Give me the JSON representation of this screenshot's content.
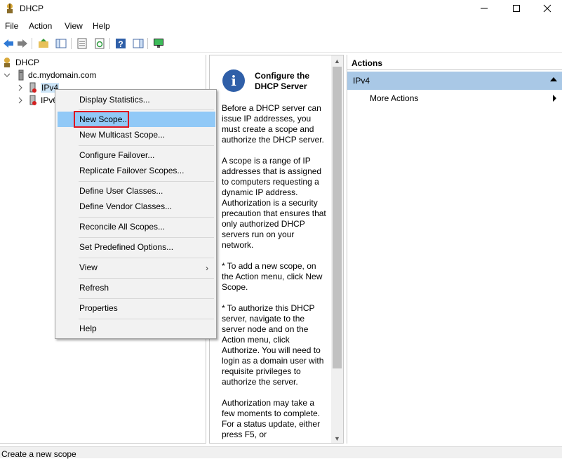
{
  "window": {
    "title": "DHCP"
  },
  "menubar": {
    "items": [
      "File",
      "Action",
      "View",
      "Help"
    ]
  },
  "tree": {
    "root": "DHCP",
    "server": "dc.mydomain.com",
    "ipv4": "IPv4",
    "ipv6": "IPv6"
  },
  "info": {
    "title": "Configure the DHCP Server",
    "paragraphs": [
      "Before a DHCP server can issue IP addresses, you must create a scope and authorize the DHCP server.",
      "A scope is a range of IP addresses that is assigned to computers requesting a dynamic IP address. Authorization is a security precaution that ensures that only authorized DHCP servers run on your network.",
      "* To add a new scope, on the Action menu, click New Scope.",
      "* To authorize this DHCP server, navigate to the server node and on the Action menu, click Authorize. You will need to login as a domain user with requisite privileges to authorize the server.",
      "Authorization may take a few moments to complete. For a status update, either press F5, or"
    ]
  },
  "actions": {
    "header": "Actions",
    "section": "IPv4",
    "more": "More Actions"
  },
  "context_menu": {
    "items": [
      "Display Statistics...",
      "New Scope...",
      "New Multicast Scope...",
      "Configure Failover...",
      "Replicate Failover Scopes...",
      "Define User Classes...",
      "Define Vendor Classes...",
      "Reconcile All Scopes...",
      "Set Predefined Options...",
      "View",
      "Refresh",
      "Properties",
      "Help"
    ],
    "highlighted": "New Scope..."
  },
  "status": {
    "text": "Create a new scope"
  },
  "colors": {
    "highlight": "#91c9f7",
    "actions_section": "#a9c8e6",
    "annotation_box": "#e0141e"
  }
}
